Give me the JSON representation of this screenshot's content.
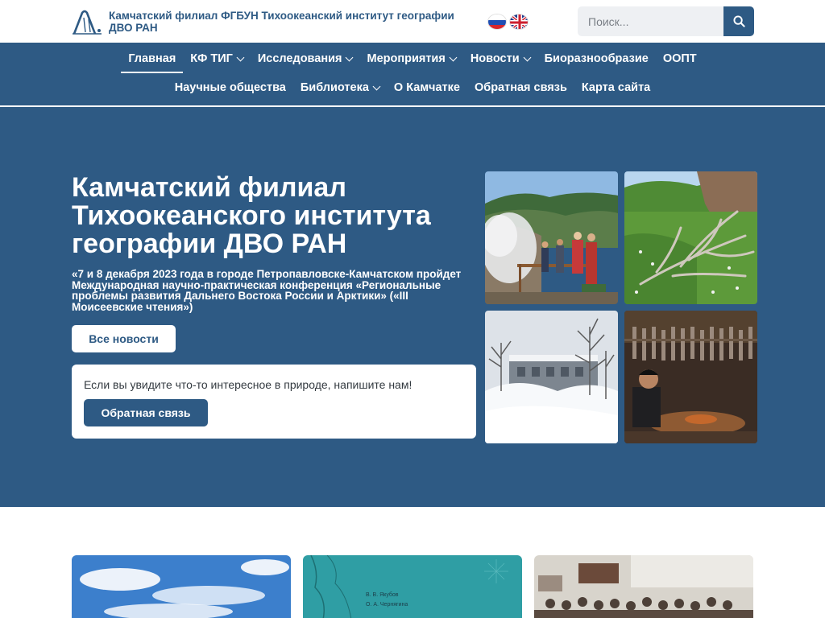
{
  "header": {
    "org_name": "Камчатский филиал ФГБУН Тихоокеанский институт географии ДВО РАН",
    "search_placeholder": "Поиск..."
  },
  "nav": {
    "row1": [
      {
        "label": "Главная",
        "dropdown": false,
        "active": true
      },
      {
        "label": "КФ ТИГ",
        "dropdown": true
      },
      {
        "label": "Исследования",
        "dropdown": true
      },
      {
        "label": "Мероприятия",
        "dropdown": true
      },
      {
        "label": "Новости",
        "dropdown": true
      },
      {
        "label": "Биоразнообразие",
        "dropdown": false
      },
      {
        "label": "ООПТ",
        "dropdown": false
      }
    ],
    "row2": [
      {
        "label": "Научные общества",
        "dropdown": false
      },
      {
        "label": "Библиотека",
        "dropdown": true
      },
      {
        "label": "О Камчатке",
        "dropdown": false
      },
      {
        "label": "Обратная связь",
        "dropdown": false
      },
      {
        "label": "Карта сайта",
        "dropdown": false
      }
    ]
  },
  "hero": {
    "title": "Камчатский филиал Тихоокеанского института географии ДВО РАН",
    "announcement": "«7 и 8 декабря 2023 года в городе Петропавловске-Камчатском пройдет Международная научно-практическая конференция «Региональные проблемы развития Дальнего Востока России и Арктики» («III Моисеевские чтения»)",
    "news_button": "Все новости",
    "nature_text": "Если вы увидите что-то интересное в природе, напишите нам!",
    "feedback_button": "Обратная связь"
  },
  "cards": {
    "book_author_1": "В. В. Якубов",
    "book_author_2": "О. А. Чернягина"
  },
  "colors": {
    "brand": "#2e5a84",
    "search_bg": "#eef0f3",
    "white": "#ffffff"
  },
  "icons": {
    "logo": "mountain-logo-icon",
    "search": "search-icon",
    "flag_ru": "flag-ru-icon",
    "flag_en": "flag-uk-icon"
  }
}
